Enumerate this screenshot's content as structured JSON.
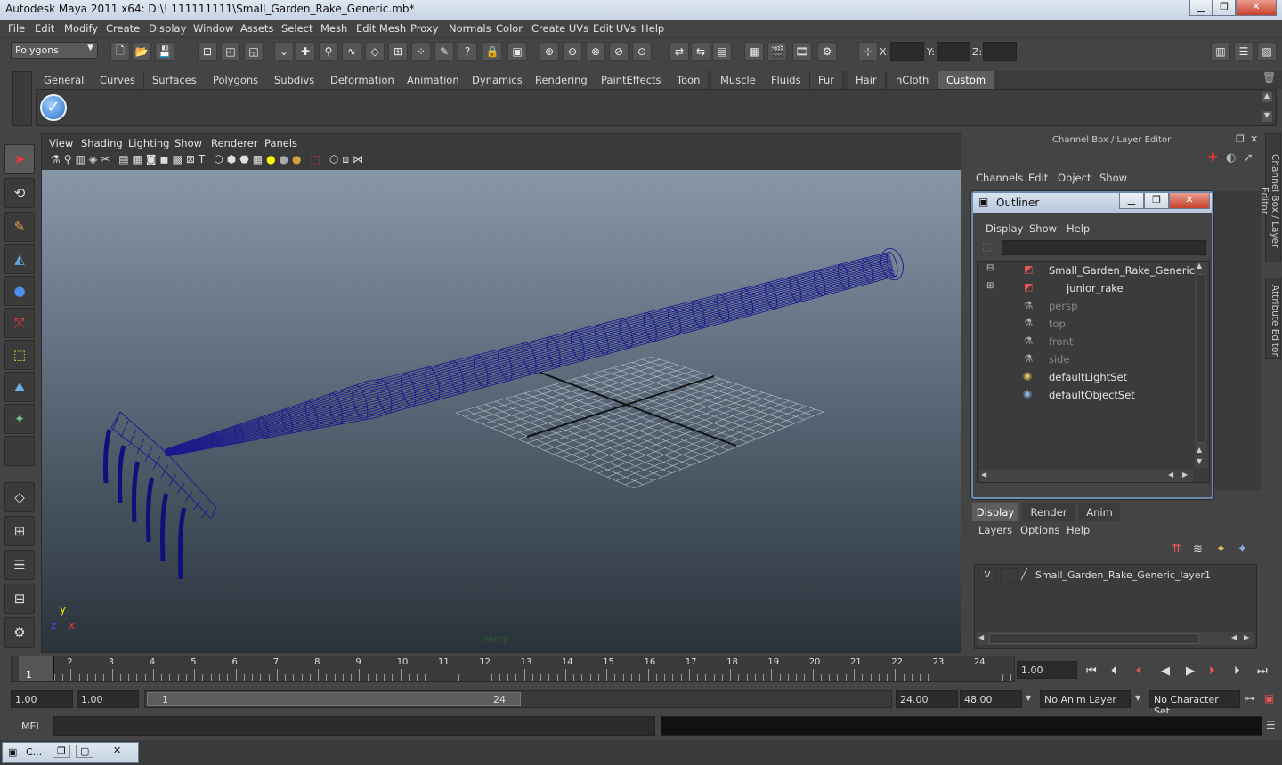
{
  "window": {
    "title": "Autodesk Maya 2011 x64: D:\\! 111111111\\Small_Garden_Rake_Generic.mb*",
    "minimize": "▁",
    "maximize": "❐",
    "close": "✕"
  },
  "menu": [
    "File",
    "Edit",
    "Modify",
    "Create",
    "Display",
    "Window",
    "Assets",
    "Select",
    "Mesh",
    "Edit Mesh",
    "Proxy",
    "Normals",
    "Color",
    "Create UVs",
    "Edit UVs",
    "Help"
  ],
  "status_line": {
    "mode": "Polygons",
    "x_label": "X:",
    "y_label": "Y:",
    "z_label": "Z:"
  },
  "shelf": {
    "tabs": [
      "General",
      "Curves",
      "Surfaces",
      "Polygons",
      "Subdivs",
      "Deformation",
      "Animation",
      "Dynamics",
      "Rendering",
      "PaintEffects",
      "Toon",
      "Muscle",
      "Fluids",
      "Fur",
      "Hair",
      "nCloth",
      "Custom"
    ],
    "active": "Custom"
  },
  "panel": {
    "menu": [
      "View",
      "Shading",
      "Lighting",
      "Show",
      "Renderer",
      "Panels"
    ],
    "camera_label": "persp",
    "axis_y": "y",
    "axis_x": "x",
    "axis_z": "z"
  },
  "channel_box": {
    "title": "Channel Box / Layer Editor",
    "menu": [
      "Channels",
      "Edit",
      "Object",
      "Show"
    ]
  },
  "side_tabs": {
    "channel_box": "Channel Box / Layer Editor",
    "attribute_editor": "Attribute Editor"
  },
  "outliner": {
    "title": "Outliner",
    "menu": [
      "Display",
      "Show",
      "Help"
    ],
    "items": [
      {
        "label": "Small_Garden_Rake_Generic",
        "dim": false
      },
      {
        "label": "junior_rake",
        "dim": false
      },
      {
        "label": "persp",
        "dim": true
      },
      {
        "label": "top",
        "dim": true
      },
      {
        "label": "front",
        "dim": true
      },
      {
        "label": "side",
        "dim": true
      },
      {
        "label": "defaultLightSet",
        "dim": false
      },
      {
        "label": "defaultObjectSet",
        "dim": false
      }
    ]
  },
  "layer_editor": {
    "tabs": [
      "Display",
      "Render",
      "Anim"
    ],
    "active_tab": "Display",
    "menu": [
      "Layers",
      "Options",
      "Help"
    ],
    "layer": {
      "visibility": "V",
      "name": "Small_Garden_Rake_Generic_layer1"
    }
  },
  "timeline": {
    "ticks": [
      "1",
      "2",
      "3",
      "4",
      "5",
      "6",
      "7",
      "8",
      "9",
      "10",
      "11",
      "12",
      "13",
      "14",
      "15",
      "16",
      "17",
      "18",
      "19",
      "20",
      "21",
      "22",
      "23",
      "24"
    ],
    "current_frame": "1",
    "current_time": "1.00"
  },
  "range": {
    "start": "1.00",
    "playback_start": "1.00",
    "slider_start": "1",
    "slider_end": "24",
    "playback_end": "24.00",
    "end": "48.00",
    "anim_layer": "No Anim Layer",
    "character_set": "No Character Set"
  },
  "command_line": {
    "label": "MEL"
  },
  "taskbar": {
    "item": "C..."
  },
  "colors": {
    "wireframe": "#1a1a8c",
    "grid": "#b8c0c8",
    "outliner_border": "#6d8bb0"
  }
}
